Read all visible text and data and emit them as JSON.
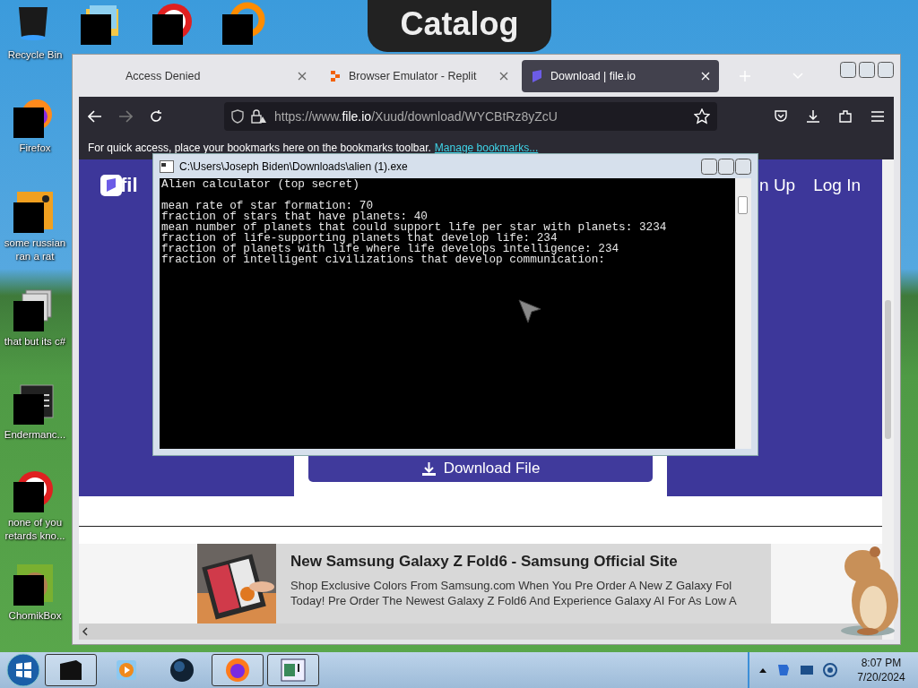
{
  "desktop": {
    "icons": [
      {
        "label": "Recycle Bin",
        "kind": "bin",
        "censored": false
      },
      {
        "label": "Firefox",
        "kind": "firefox",
        "censored": true
      },
      {
        "label": "some russian ran a rat",
        "kind": "app",
        "censored": true
      },
      {
        "label": "that but its c#",
        "kind": "copy",
        "censored": true
      },
      {
        "label": "Endermanc...",
        "kind": "window",
        "censored": true
      },
      {
        "label": "none of you retards kno...",
        "kind": "round",
        "censored": true
      },
      {
        "label": "ChomikBox",
        "kind": "hamster",
        "censored": true
      }
    ],
    "top_icons": [
      {
        "kind": "folder",
        "censored": true
      },
      {
        "kind": "round",
        "censored": true
      },
      {
        "kind": "ring",
        "censored": true
      }
    ]
  },
  "catalog_window": {
    "title": "Catalog"
  },
  "browser": {
    "tabs": [
      {
        "label": "Access Denied",
        "kind": "plain",
        "selected": false
      },
      {
        "label": "Browser Emulator - Replit",
        "kind": "replit",
        "selected": false
      },
      {
        "label": "Download | file.io",
        "kind": "fileio",
        "selected": true
      }
    ],
    "url": {
      "prefix": "https://www.",
      "domain": "file.io",
      "path": "/Xuud/download/WYCBtRz8yZcU"
    },
    "bookmarks_bar": {
      "text": "For quick access, place your bookmarks here on the bookmarks toolbar.",
      "link": "Manage bookmarks..."
    },
    "site": {
      "logo": "fil",
      "nav": [
        "n Up",
        "Log In"
      ],
      "download_button": "Download File",
      "ad": {
        "title": "New Samsung Galaxy Z Fold6 - Samsung Official Site",
        "lines": [
          "Shop Exclusive Colors From Samsung.com When You Pre Order A New Z Galaxy Fol",
          "Today! Pre Order The Newest Galaxy Z Fold6 And Experience Galaxy AI For As Low A"
        ]
      }
    }
  },
  "console": {
    "title": "C:\\Users\\Joseph Biden\\Downloads\\alien (1).exe",
    "heading": "Alien calculator (top secret)",
    "lines": [
      "mean rate of star formation: 70",
      "fraction of stars that have planets: 40",
      "mean number of planets that could support life per star with planets: 3234",
      "fraction of life-supporting planets that develop life: 234",
      "fraction of planets with life where life develops intelligence: 234",
      "fraction of intelligent civilizations that develop communication:"
    ]
  },
  "taskbar": {
    "buttons": [
      {
        "kind": "dark",
        "open": true
      },
      {
        "kind": "player",
        "open": false
      },
      {
        "kind": "globe",
        "open": false
      },
      {
        "kind": "firefox",
        "open": true
      },
      {
        "kind": "console",
        "open": true
      }
    ],
    "clock": {
      "time": "8:07 PM",
      "date": "7/20/2024"
    }
  }
}
